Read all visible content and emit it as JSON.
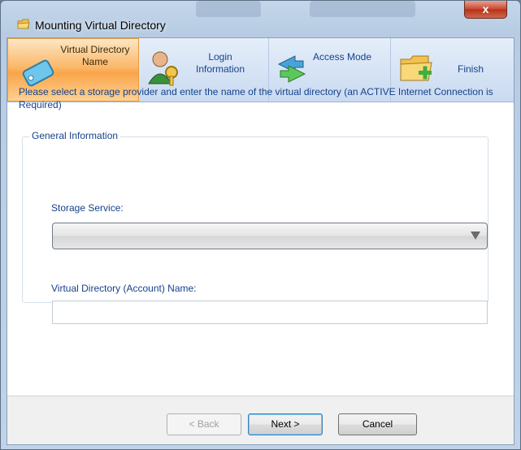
{
  "window": {
    "title": "Mounting Virtual Directory",
    "close_label": "x"
  },
  "steps": [
    {
      "label": "Virtual Directory Name",
      "icon": "nametag-icon",
      "active": true
    },
    {
      "label": "Login Information",
      "icon": "user-key-icon",
      "active": false
    },
    {
      "label": "Access Mode",
      "icon": "arrows-icon",
      "active": false
    },
    {
      "label": "Finish",
      "icon": "folder-add-icon",
      "active": false
    }
  ],
  "instructions": "Please select a storage provider and enter the name of the virtual directory (an ACTIVE Internet Connection is Required)",
  "general_info": {
    "title": "General Information",
    "storage_label": "Storage Service:",
    "storage_value": "",
    "name_label": "Virtual Directory (Account) Name:",
    "name_value": ""
  },
  "buttons": {
    "back": "< Back",
    "next": "Next >",
    "cancel": "Cancel"
  },
  "colors": {
    "active_step": "#f9a44a",
    "accent_text": "#15428b",
    "close_button": "#c9452c"
  }
}
